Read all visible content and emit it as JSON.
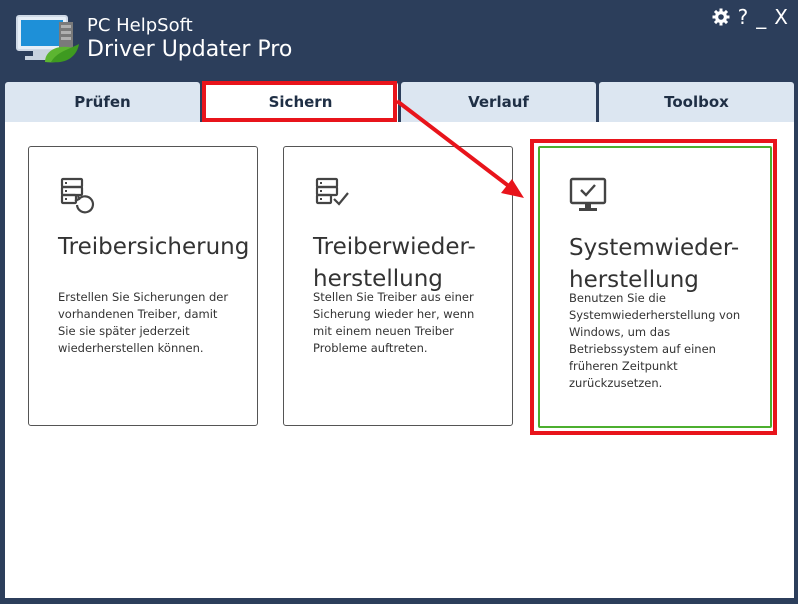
{
  "app": {
    "brand": "PC HelpSoft",
    "title": "Driver Updater Pro"
  },
  "window_controls": {
    "help": "?",
    "minimize": "_",
    "close": "X"
  },
  "tabs": [
    {
      "label": "Prüfen",
      "active": false
    },
    {
      "label": "Sichern",
      "active": true
    },
    {
      "label": "Verlauf",
      "active": false
    },
    {
      "label": "Toolbox",
      "active": false
    }
  ],
  "cards": [
    {
      "icon": "driver-backup-icon",
      "title": "Treibersicherung",
      "description": "Erstellen Sie Sicherungen der vorhandenen Treiber, damit Sie sie später jederzeit wiederherstellen können."
    },
    {
      "icon": "driver-restore-icon",
      "title": "Treiberwieder-\nherstellung",
      "description": "Stellen Sie Treiber aus einer Sicherung wieder her, wenn mit einem neuen Treiber Probleme auftreten."
    },
    {
      "icon": "system-restore-icon",
      "title": "Systemwieder-\nherstellung",
      "description": "Benutzen Sie die Systemwiederherstellung von Windows, um das Betriebssystem auf einen früheren Zeitpunkt zurückzusetzen."
    }
  ],
  "colors": {
    "titlebar": "#2c3e5b",
    "tab_inactive": "#dce6f1",
    "highlight": "#e8141b",
    "selected_card_border": "#4caf2f"
  }
}
